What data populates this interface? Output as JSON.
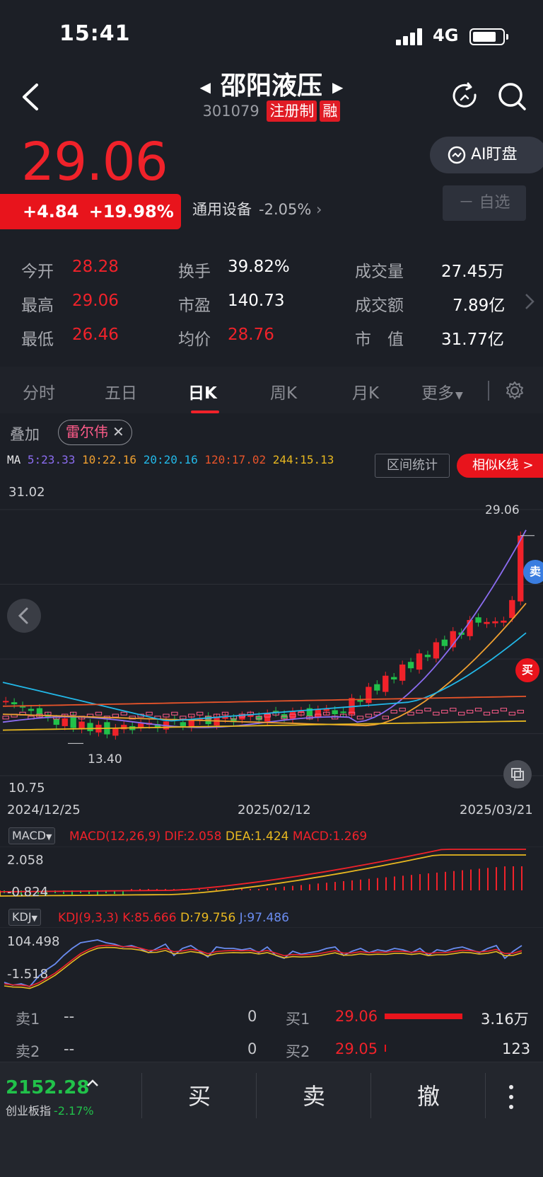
{
  "status": {
    "time": "15:41",
    "network": "4G"
  },
  "header": {
    "name": "邵阳液压",
    "code": "301079",
    "tag_registration": "注册制",
    "tag_margin": "融"
  },
  "quote": {
    "price": "29.06",
    "change": "+4.84",
    "change_pct": "+19.98%",
    "sector": "通用设备",
    "sector_pct": "-2.05%",
    "ai_button": "AI盯盘",
    "watch_button": "－ 自选"
  },
  "stats": {
    "open_label": "今开",
    "open": "28.28",
    "high_label": "最高",
    "high": "29.06",
    "low_label": "最低",
    "low": "26.46",
    "turnover_label": "换手",
    "turnover": "39.82%",
    "pe_label": "市盈",
    "pe": "140.73",
    "avg_label": "均价",
    "avg": "28.76",
    "volume_label": "成交量",
    "volume": "27.45万",
    "amount_label": "成交额",
    "amount": "7.89亿",
    "mcap_label": "市　值",
    "mcap": "31.77亿"
  },
  "tabs": {
    "minute": "分时",
    "five_day": "五日",
    "day": "日K",
    "week": "周K",
    "month": "月K",
    "more": "更多"
  },
  "overlay": {
    "label": "叠加",
    "chip": "雷尔伟"
  },
  "chart": {
    "ma_label": "MA",
    "ma5": "5:23.33",
    "ma10": "10:22.16",
    "ma20": "20:20.16",
    "ma120": "120:17.02",
    "ma244": "244:15.13",
    "range_button": "区间统计",
    "similar_button": "相似K线 >",
    "y_max": "31.02",
    "y_min": "10.75",
    "high_marker": "29.06",
    "low_marker": "13.40",
    "date_start": "2024/12/25",
    "date_mid": "2025/02/12",
    "date_end": "2025/03/21",
    "sell_badge": "卖",
    "buy_badge": "买",
    "colors": {
      "up": "#f0222a",
      "down": "#21c14a",
      "ma5": "#8b6cf0",
      "ma10": "#f0a030",
      "ma20": "#22b8e8",
      "ma120": "#e8542a",
      "ma244": "#e8b820"
    }
  },
  "macd": {
    "name": "MACD",
    "params": "MACD(12,26,9)",
    "dif": "DIF:2.058",
    "dea": "DEA:1.424",
    "macd": "MACD:1.269",
    "axis_top": "2.058",
    "axis_bottom": "-0.824"
  },
  "kdj": {
    "name": "KDJ",
    "params": "KDJ(9,3,3)",
    "k": "K:85.666",
    "d": "D:79.756",
    "j": "J:97.486",
    "axis_top": "104.498",
    "axis_bottom": "-1.518"
  },
  "orderbook": {
    "sell1_label": "卖1",
    "sell1_price": "--",
    "sell1_vol": "0",
    "sell2_label": "卖2",
    "sell2_price": "--",
    "sell2_vol": "0",
    "buy1_label": "买1",
    "buy1_price": "29.06",
    "buy1_vol": "3.16万",
    "buy2_label": "买2",
    "buy2_price": "29.05",
    "buy2_vol": "123"
  },
  "bottom": {
    "index_value": "2152.28",
    "index_name": "创业板指",
    "index_change": "-2.17%",
    "buy": "买",
    "sell": "卖",
    "cancel": "撤"
  }
}
